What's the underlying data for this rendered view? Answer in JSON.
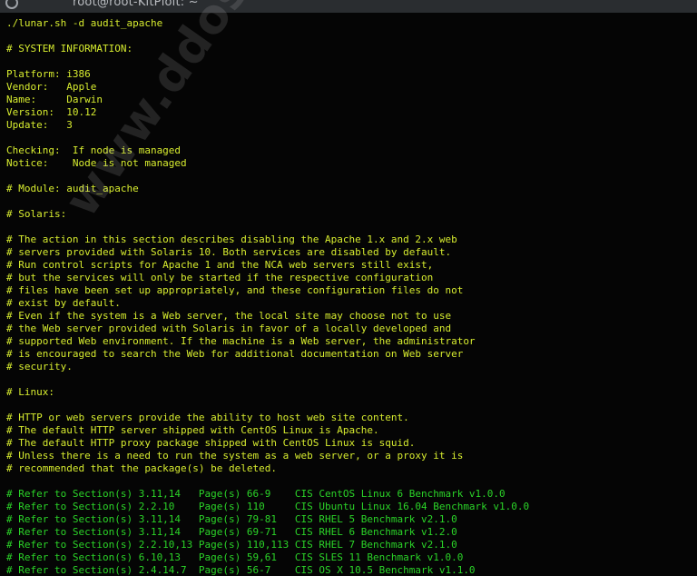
{
  "window": {
    "title": "root@root-KitPloit: ~"
  },
  "watermark": "www.ddos-soft.net",
  "terminal": {
    "lines": [
      "./lunar.sh -d audit_apache",
      "",
      "# SYSTEM INFORMATION:",
      "",
      "Platform: i386",
      "Vendor:   Apple",
      "Name:     Darwin",
      "Version:  10.12",
      "Update:   3",
      "",
      "Checking:  If node is managed",
      "Notice:    Node is not managed",
      "",
      "# Module: audit_apache",
      "",
      "# Solaris:",
      "",
      "# The action in this section describes disabling the Apache 1.x and 2.x web",
      "# servers provided with Solaris 10. Both services are disabled by default.",
      "# Run control scripts for Apache 1 and the NCA web servers still exist,",
      "# but the services will only be started if the respective configuration",
      "# files have been set up appropriately, and these configuration files do not",
      "# exist by default.",
      "# Even if the system is a Web server, the local site may choose not to use",
      "# the Web server provided with Solaris in favor of a locally developed and",
      "# supported Web environment. If the machine is a Web server, the administrator",
      "# is encouraged to search the Web for additional documentation on Web server",
      "# security.",
      "",
      "# Linux:",
      "",
      "# HTTP or web servers provide the ability to host web site content.",
      "# The default HTTP server shipped with CentOS Linux is Apache.",
      "# The default HTTP proxy package shipped with CentOS Linux is squid.",
      "# Unless there is a need to run the system as a web server, or a proxy it is",
      "# recommended that the package(s) be deleted.",
      "",
      "# Refer to Section(s) 3.11,14   Page(s) 66-9    CIS CentOS Linux 6 Benchmark v1.0.0",
      "# Refer to Section(s) 2.2.10    Page(s) 110     CIS Ubuntu Linux 16.04 Benchmark v1.0.0",
      "# Refer to Section(s) 3.11,14   Page(s) 79-81   CIS RHEL 5 Benchmark v2.1.0",
      "# Refer to Section(s) 3.11,14   Page(s) 69-71   CIS RHEL 6 Benchmark v1.2.0",
      "# Refer to Section(s) 2.2.10,13 Page(s) 110,113 CIS RHEL 7 Benchmark v2.1.0",
      "# Refer to Section(s) 6.10,13   Page(s) 59,61   CIS SLES 11 Benchmark v1.0.0",
      "# Refer to Section(s) 2.4.14.7  Page(s) 56-7    CIS OS X 10.5 Benchmark v1.1.0"
    ]
  },
  "colors": {
    "background": "#050505",
    "text_yellow": "#d7ec2f",
    "text_green": "#2bd428",
    "titlebar": "#2a2d30"
  }
}
